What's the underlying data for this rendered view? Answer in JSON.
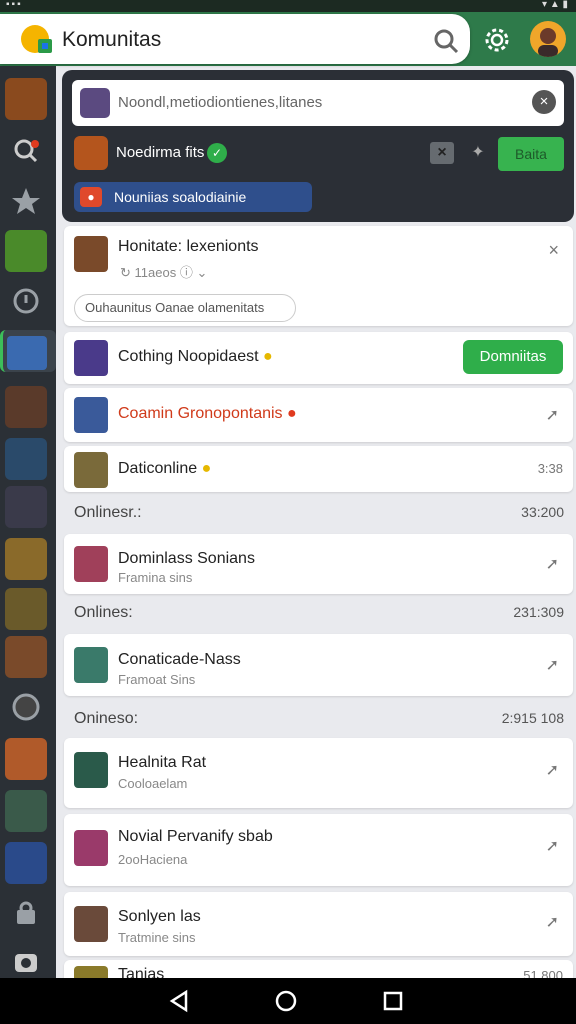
{
  "app": {
    "title": "Komunitas"
  },
  "composer": {
    "input_text": "Noondl,metiodiontienes,litanes",
    "row_text": "Noedirma fits",
    "action_button": "Baita",
    "chip_text": "Nouniias soalodiainie"
  },
  "notification": {
    "title": "Honitate: lexenionts",
    "meta": "11aeos",
    "pill": "Ouhaunitus Oanae olamenitats"
  },
  "items": [
    {
      "name": "Cothing Noopidaest",
      "button": "Domniitas"
    },
    {
      "name": "Coamin Gronopontanis"
    },
    {
      "name": "Daticonline",
      "right": "3:38"
    }
  ],
  "sections": [
    {
      "label": "Onlinesr.:",
      "time": "33:200"
    },
    {
      "label": "Onlines:",
      "time": "231:309"
    },
    {
      "label": "Onineso:",
      "time": "2:915 108"
    }
  ],
  "people": [
    {
      "name": "Dominlass Sonians",
      "sub": "Framina sins"
    },
    {
      "name": "Conaticade-Nass",
      "sub": "Framoat Sins"
    },
    {
      "name": "Healnita Rat",
      "sub": "Cooloaelam"
    },
    {
      "name": "Novial Pervanify sbab",
      "sub": "2ooHaciena"
    },
    {
      "name": "Sonlyen las",
      "sub": "Tratmine sins"
    },
    {
      "name": "Tanias",
      "sub": "51.800"
    }
  ],
  "colors": {
    "accent": "#2fae4a",
    "sidebar": "#2b3036",
    "header": "#2e7a4a",
    "chip": "#2f4f8c",
    "alert": "#e03a1e"
  }
}
